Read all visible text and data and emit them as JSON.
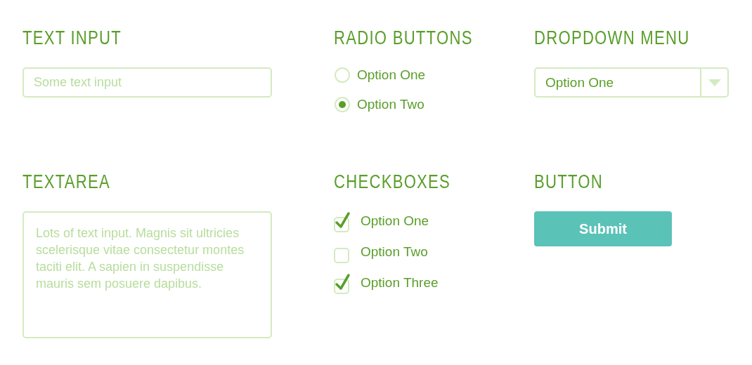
{
  "text_input": {
    "heading": "TEXT INPUT",
    "placeholder": "Some text input"
  },
  "radio_buttons": {
    "heading": "RADIO BUTTONS",
    "options": [
      {
        "label": "Option One",
        "selected": false
      },
      {
        "label": "Option Two",
        "selected": true
      }
    ]
  },
  "dropdown_menu": {
    "heading": "DROPDOWN MENU",
    "value": "Option One"
  },
  "textarea": {
    "heading": "TEXTAREA",
    "placeholder": "Lots of text input. Magnis sit ultricies scelerisque vitae consectetur montes taciti elit. A sapien in suspendisse mauris sem posuere dapibus."
  },
  "checkboxes": {
    "heading": "CHECKBOXES",
    "options": [
      {
        "label": "Option One",
        "checked": true
      },
      {
        "label": "Option Two",
        "checked": false
      },
      {
        "label": "Option Three",
        "checked": true
      }
    ]
  },
  "button": {
    "heading": "BUTTON",
    "label": "Submit"
  }
}
